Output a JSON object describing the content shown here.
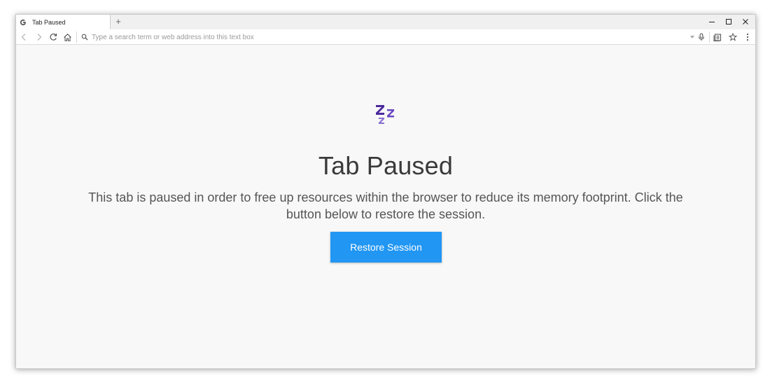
{
  "tab": {
    "title": "Tab Paused",
    "favicon_icon": "google-g-icon",
    "new_tab_label": "+"
  },
  "window_controls": {
    "minimize_icon": "minimize-icon",
    "maximize_icon": "maximize-icon",
    "close_icon": "close-icon"
  },
  "toolbar": {
    "back_icon": "back-arrow-icon",
    "forward_icon": "forward-arrow-icon",
    "reload_icon": "reload-icon",
    "home_icon": "home-icon",
    "search_icon": "search-icon",
    "address_placeholder": "Type a search term or web address into this text box",
    "address_value": "",
    "dropdown_icon": "chevron-down-icon",
    "mic_icon": "microphone-icon",
    "reading_list_icon": "reading-list-icon",
    "bookmark_icon": "star-icon",
    "menu_icon": "more-vertical-icon"
  },
  "page": {
    "icon": "zzz-sleep-icon",
    "title": "Tab Paused",
    "description": "This tab is paused in order to free up resources within the browser to reduce its memory footprint. Click the button below to restore the session.",
    "restore_button_label": "Restore Session",
    "accent_color": "#2196f3",
    "icon_colors": [
      "#4b2a9e",
      "#8a6fd1"
    ]
  }
}
